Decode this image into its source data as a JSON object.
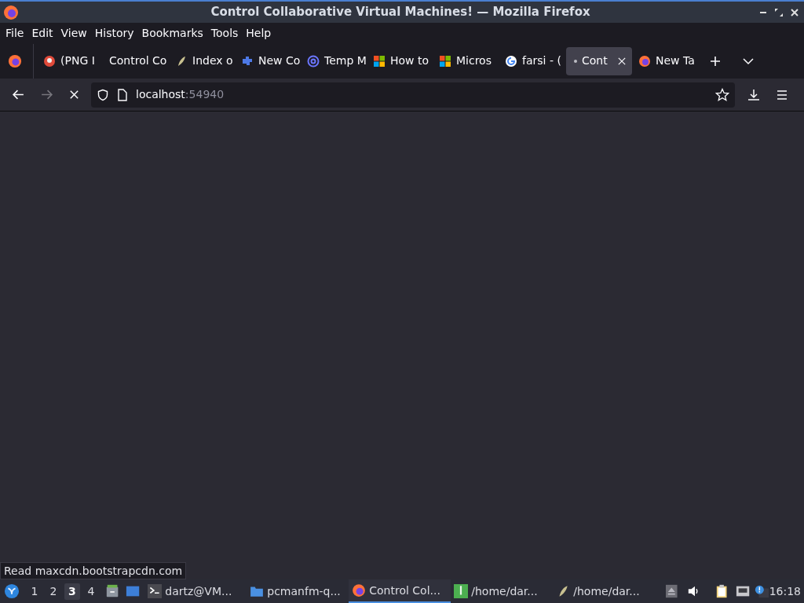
{
  "window": {
    "title": "Control Collaborative Virtual Machines! — Mozilla Firefox"
  },
  "menu": [
    "File",
    "Edit",
    "View",
    "History",
    "Bookmarks",
    "Tools",
    "Help"
  ],
  "tabs": [
    {
      "label": "(PNG I",
      "selected": false
    },
    {
      "label": "Control Co",
      "selected": false
    },
    {
      "label": "Index o",
      "selected": false
    },
    {
      "label": "New Co",
      "selected": false
    },
    {
      "label": "Temp M",
      "selected": false
    },
    {
      "label": "How to",
      "selected": false
    },
    {
      "label": "Micros",
      "selected": false
    },
    {
      "label": "farsi - (",
      "selected": false
    },
    {
      "label": "Cont",
      "selected": true
    },
    {
      "label": "New Ta",
      "selected": false
    }
  ],
  "address_bar": {
    "host": "localhost",
    "port": ":54940"
  },
  "status_text": "Read maxcdn.bootstrapcdn.com",
  "taskbar": {
    "workspaces": [
      {
        "label": "1",
        "selected": false
      },
      {
        "label": "2",
        "selected": false
      },
      {
        "label": "3",
        "selected": true
      },
      {
        "label": "4",
        "selected": false
      }
    ],
    "tasks": [
      {
        "label": "dartz@VM...",
        "selected": false
      },
      {
        "label": "pcmanfm-q...",
        "selected": false
      },
      {
        "label": "Control Col...",
        "selected": true
      },
      {
        "label": "/home/dar...",
        "selected": false
      },
      {
        "label": "/home/dar...",
        "selected": false
      }
    ],
    "clock": "16:18"
  }
}
